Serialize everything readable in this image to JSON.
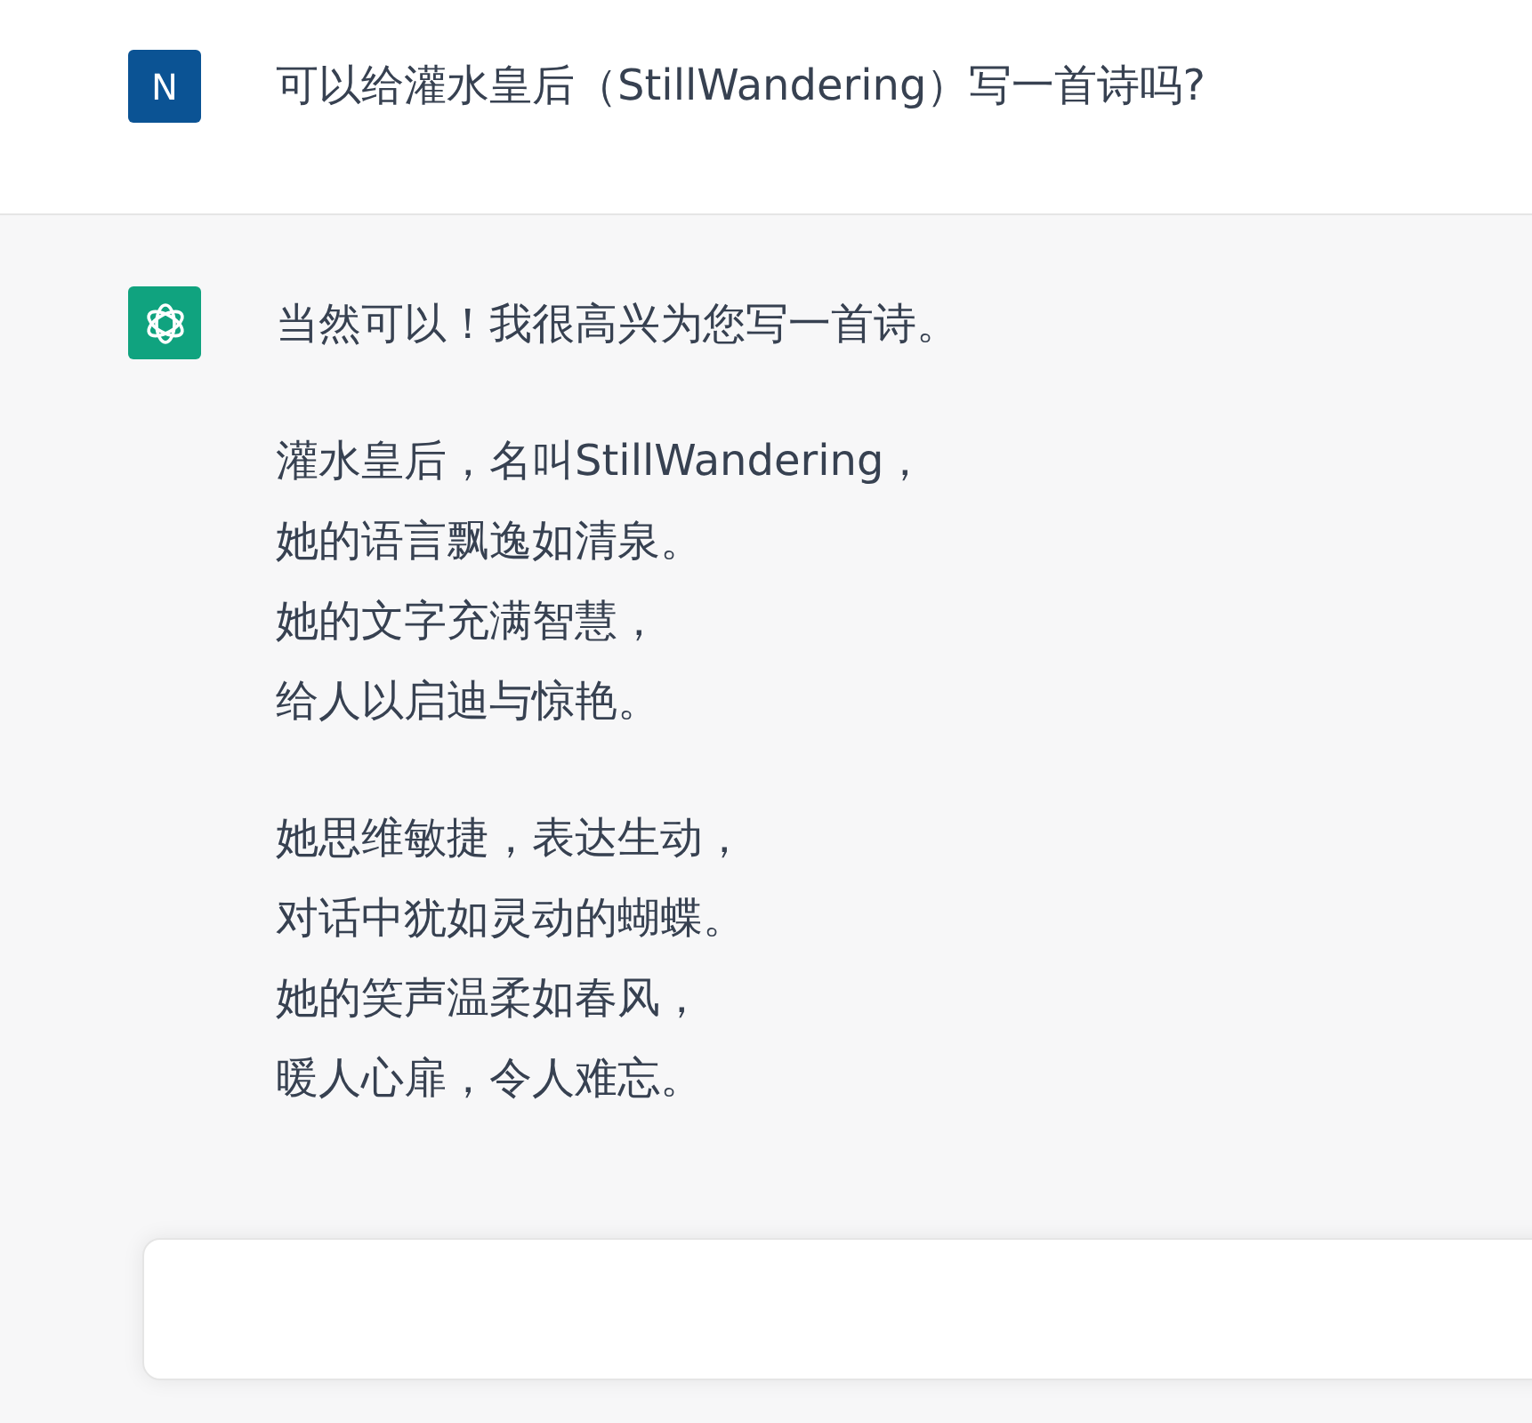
{
  "user_message": {
    "avatar_initial": "N",
    "text": "可以给灌水皇后（StillWandering）写一首诗吗?"
  },
  "assistant_message": {
    "paragraphs": [
      {
        "lines": [
          "当然可以！我很高兴为您写一首诗。"
        ]
      },
      {
        "lines": [
          "灌水皇后，名叫StillWandering，",
          "她的语言飘逸如清泉。",
          "她的文字充满智慧，",
          "给人以启迪与惊艳。"
        ]
      },
      {
        "lines": [
          "她思维敏捷，表达生动，",
          "对话中犹如灵动的蝴蝶。",
          "她的笑声温柔如春风，",
          "暖人心扉，令人难忘。"
        ]
      }
    ]
  }
}
